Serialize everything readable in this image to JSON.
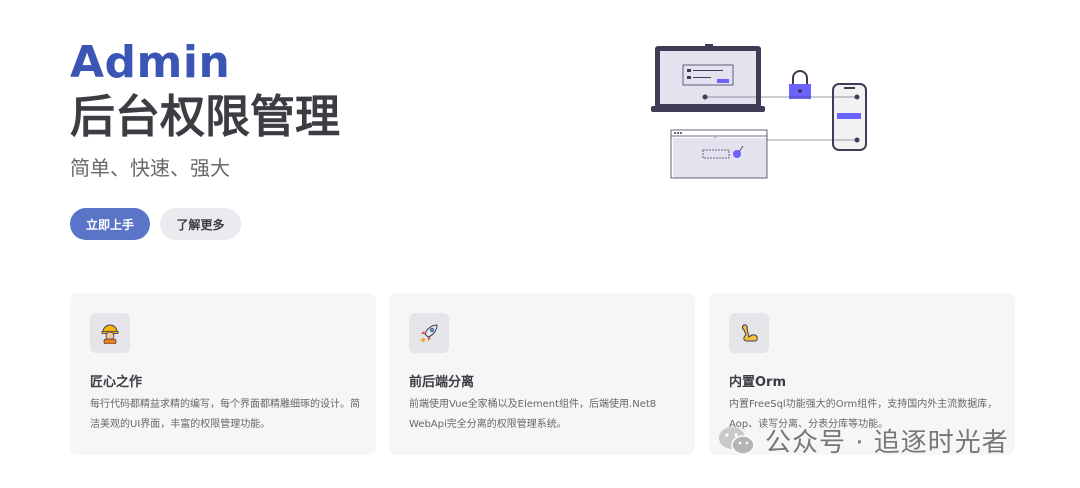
{
  "hero": {
    "brand": "Admin",
    "name": "后台权限管理",
    "tagline": "简单、快速、强大",
    "primary_button": "立即上手",
    "secondary_button": "了解更多"
  },
  "features": [
    {
      "icon": "worker-icon",
      "title": "匠心之作",
      "desc": "每行代码都精益求精的编写，每个界面都精雕细琢的设计。简洁美观的UI界面，丰富的权限管理功能。"
    },
    {
      "icon": "rocket-icon",
      "title": "前后端分离",
      "desc": "前端使用Vue全家桶以及Element组件，后端使用.Net8 WebApi完全分离的权限管理系统。"
    },
    {
      "icon": "flexed-biceps-icon",
      "title": "内置Orm",
      "desc": "内置FreeSql功能强大的Orm组件，支持国内外主流数据库，Aop、读写分离、分表分库等功能。"
    }
  ],
  "watermark": {
    "text": "公众号 · 追逐时光者"
  },
  "colors": {
    "accent": "#3b55b4",
    "button": "#5a75c8",
    "card_bg": "#f6f6f7"
  }
}
